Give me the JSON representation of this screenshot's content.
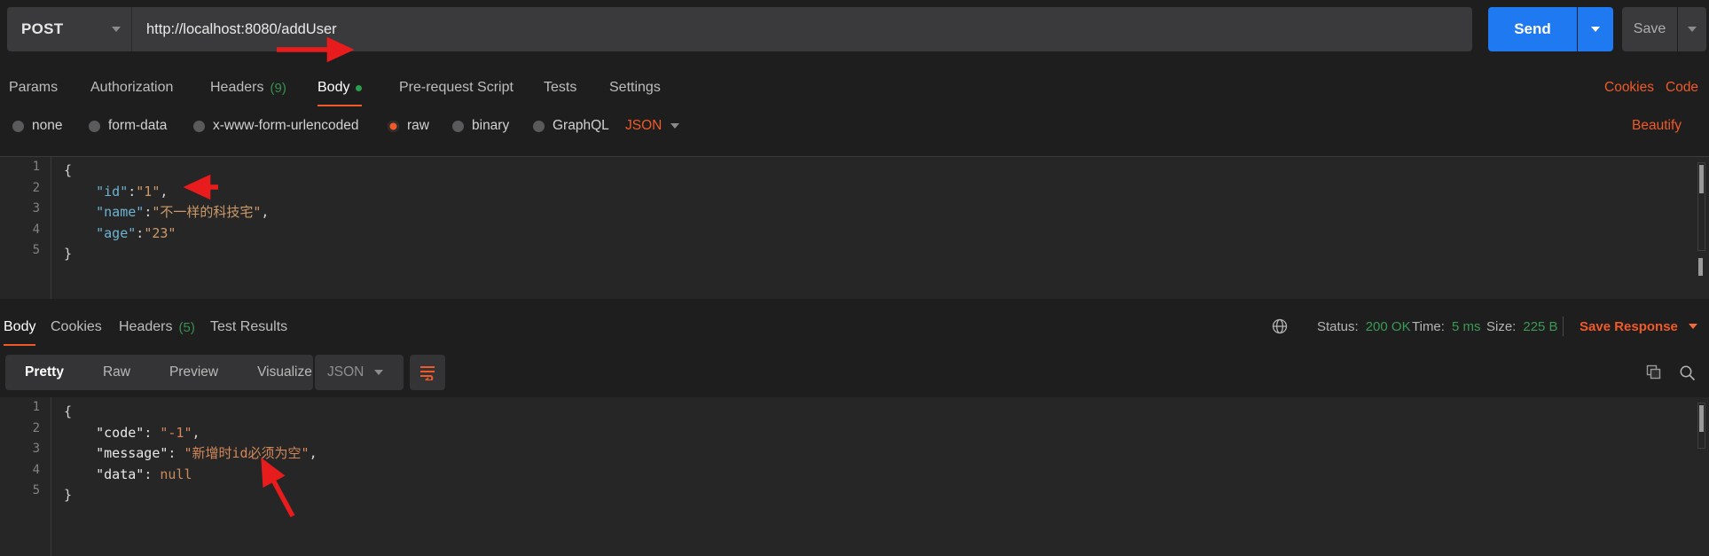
{
  "request": {
    "method": "POST",
    "url": "http://localhost:8080/addUser",
    "send_label": "Send",
    "save_label": "Save",
    "tabs": [
      {
        "label": "Params",
        "count": "",
        "active": false
      },
      {
        "label": "Authorization",
        "count": "",
        "active": false
      },
      {
        "label": "Headers",
        "count": "(9)",
        "active": false
      },
      {
        "label": "Body",
        "count": "",
        "active": true
      },
      {
        "label": "Pre-request Script",
        "count": "",
        "active": false
      },
      {
        "label": "Tests",
        "count": "",
        "active": false
      },
      {
        "label": "Settings",
        "count": "",
        "active": false
      }
    ],
    "links": {
      "cookies": "Cookies",
      "code": "Code",
      "beautify": "Beautify"
    },
    "body_types": [
      {
        "label": "none",
        "selected": false
      },
      {
        "label": "form-data",
        "selected": false
      },
      {
        "label": "x-www-form-urlencoded",
        "selected": false
      },
      {
        "label": "raw",
        "selected": true
      },
      {
        "label": "binary",
        "selected": false
      },
      {
        "label": "GraphQL",
        "selected": false
      }
    ],
    "raw_format": "JSON",
    "body_lines": [
      "1",
      "2",
      "3",
      "4",
      "5"
    ],
    "body_code": {
      "line1": "{",
      "line2_key": "\"id\"",
      "line2_colon": ":",
      "line2_val": "\"1\"",
      "line2_comma": ",",
      "line3_key": "\"name\"",
      "line3_colon": ":",
      "line3_val": "\"不一样的科技宅\"",
      "line3_comma": ",",
      "line4_key": "\"age\"",
      "line4_colon": ":",
      "line4_val": "\"23\"",
      "line5": "}"
    }
  },
  "response": {
    "tabs": [
      {
        "label": "Body",
        "count": "",
        "active": true
      },
      {
        "label": "Cookies",
        "count": "",
        "active": false
      },
      {
        "label": "Headers",
        "count": "(5)",
        "active": false
      },
      {
        "label": "Test Results",
        "count": "",
        "active": false
      }
    ],
    "meta": {
      "status_label": "Status:",
      "status_value": "200 OK",
      "time_label": "Time:",
      "time_value": "5 ms",
      "size_label": "Size:",
      "size_value": "225 B",
      "save_response": "Save Response"
    },
    "views": [
      {
        "label": "Pretty",
        "active": true
      },
      {
        "label": "Raw",
        "active": false
      },
      {
        "label": "Preview",
        "active": false
      },
      {
        "label": "Visualize",
        "active": false
      }
    ],
    "format": "JSON",
    "body_lines": [
      "1",
      "2",
      "3",
      "4",
      "5"
    ],
    "body_code": {
      "line1": "{",
      "line2_key": "\"code\"",
      "line2_colon": ": ",
      "line2_val": "\"-1\"",
      "line2_comma": ",",
      "line3_key": "\"message\"",
      "line3_colon": ": ",
      "line3_val": "\"新增时id必须为空\"",
      "line3_comma": ",",
      "line4_key": "\"data\"",
      "line4_colon": ": ",
      "line4_val": "null",
      "line5": "}"
    }
  },
  "colors": {
    "accent_orange": "#f05a28",
    "send_blue": "#1f79f0",
    "status_green": "#3a9a55",
    "annotation_red": "#e81c1c",
    "background": "#1e1e1e",
    "editor_background": "#262626"
  },
  "icons": {
    "globe": "globe-icon",
    "copy": "copy-icon",
    "search": "search-icon",
    "wrap": "word-wrap-icon"
  }
}
